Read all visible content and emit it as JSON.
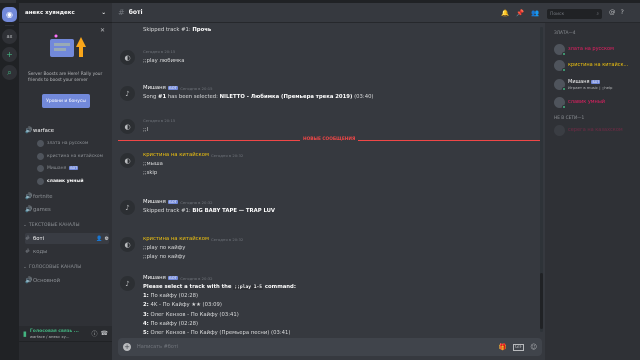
{
  "guild": {
    "name": "анекс хуяндекс",
    "menu_icon": "chevron-down-icon"
  },
  "boost": {
    "text": "Server Boosts are Here! Rally your friends to boost your server",
    "button": "Уровни и бонусы"
  },
  "sidebar": {
    "voice_active_channel": "warface",
    "voice_users": [
      "злата на русском",
      "кристина на китайском",
      "Мишаня",
      "славик умный"
    ],
    "mishanya_bot_tag": "БОТ",
    "extra_voice": [
      "fortnite",
      "games"
    ],
    "text_category": "ТЕКСТОВЫЕ КАНАЛЫ",
    "text_channels": [
      "боті",
      "коды"
    ],
    "voice_category": "ГОЛОСОВЫЕ КАНАЛЫ",
    "voice_channels": [
      "Основной"
    ],
    "voice_status": "Голосовая связь ...",
    "voice_status_sub": "warface / анекс ху..."
  },
  "chat": {
    "channel": "боті",
    "new_messages_label": "НОВЫЕ СООБЩЕНИЯ",
    "input_placeholder": "Написать #боті",
    "messages": [
      {
        "author": "",
        "lines": [
          {
            "html": "Skipped track #1: <b>Прочь</b>"
          }
        ]
      },
      {
        "author": "",
        "timestamp": "Сегодня в 20:15",
        "lines": [
          {
            "html": ";;play любимка"
          }
        ]
      },
      {
        "author": "Мишаня",
        "bot": "БОТ",
        "timestamp": "Сегодня в 20:15",
        "lines": [
          {
            "html": "Song <b>#1</b> has been selected: <b>NILETTO - Любимка (Премьера трека 2019)</b> (03:40)"
          }
        ]
      },
      {
        "author": "",
        "timestamp": "Сегодня в 20:15",
        "lines": [
          {
            "html": ";;l"
          }
        ]
      },
      {
        "author": "кристина на китайском",
        "timestamp": "Сегодня в 20:32",
        "lines": [
          {
            "html": ";;мыша"
          },
          {
            "html": ";;skip"
          }
        ]
      },
      {
        "author": "Мишаня",
        "bot": "БОТ",
        "timestamp": "Сегодня в 20:32",
        "lines": [
          {
            "html": "Skipped track #1: <b>BIG BABY TAPE — TRAP LUV</b>"
          }
        ]
      },
      {
        "author": "кристина на китайском",
        "timestamp": "Сегодня в 20:32",
        "lines": [
          {
            "html": ";;play по кайфу"
          },
          {
            "html": ";;play по кайфу"
          }
        ]
      },
      {
        "author": "Мишаня",
        "bot": "БОТ",
        "timestamp": "Сегодня в 20:32",
        "lines": [
          {
            "html": "<b>Please select a track with the <code>;;play 1-5</code> command:</b>"
          },
          {
            "html": "<b>1:</b> По кайфу (02:28)"
          },
          {
            "html": "<b>2:</b> 4K - По Кайфу ★★ (03:09)"
          },
          {
            "html": "<b>3:</b> Олег Кензов - По Кайфу (03:41)"
          },
          {
            "html": "<b>4:</b> По кайфу (02:28)"
          },
          {
            "html": "<b>5:</b> Олег Кензов - По Кайфу (Премьера песни) (03:41)"
          }
        ]
      }
    ]
  },
  "header": {
    "search_placeholder": "Поиск"
  },
  "members": {
    "online_header": "ЗЛАТА—4",
    "online": [
      {
        "name": "злата на русском",
        "color": "#e91e63",
        "sub": ""
      },
      {
        "name": "кристина на китайск...",
        "color": "#f1c40f",
        "sub": ""
      },
      {
        "name": "Мишаня",
        "color": "#ffffff",
        "sub": "Играет в music | ;;help",
        "bot": "БОТ"
      },
      {
        "name": "славик умный",
        "color": "#e91e63",
        "sub": ""
      }
    ],
    "offline_header": "НЕ В СЕТИ—1",
    "offline": [
      {
        "name": "серега на казахском",
        "color": "#e91e63"
      }
    ]
  },
  "colors": {
    "accent": "#7289da",
    "online": "#43b581",
    "new_msg": "#f04747"
  }
}
